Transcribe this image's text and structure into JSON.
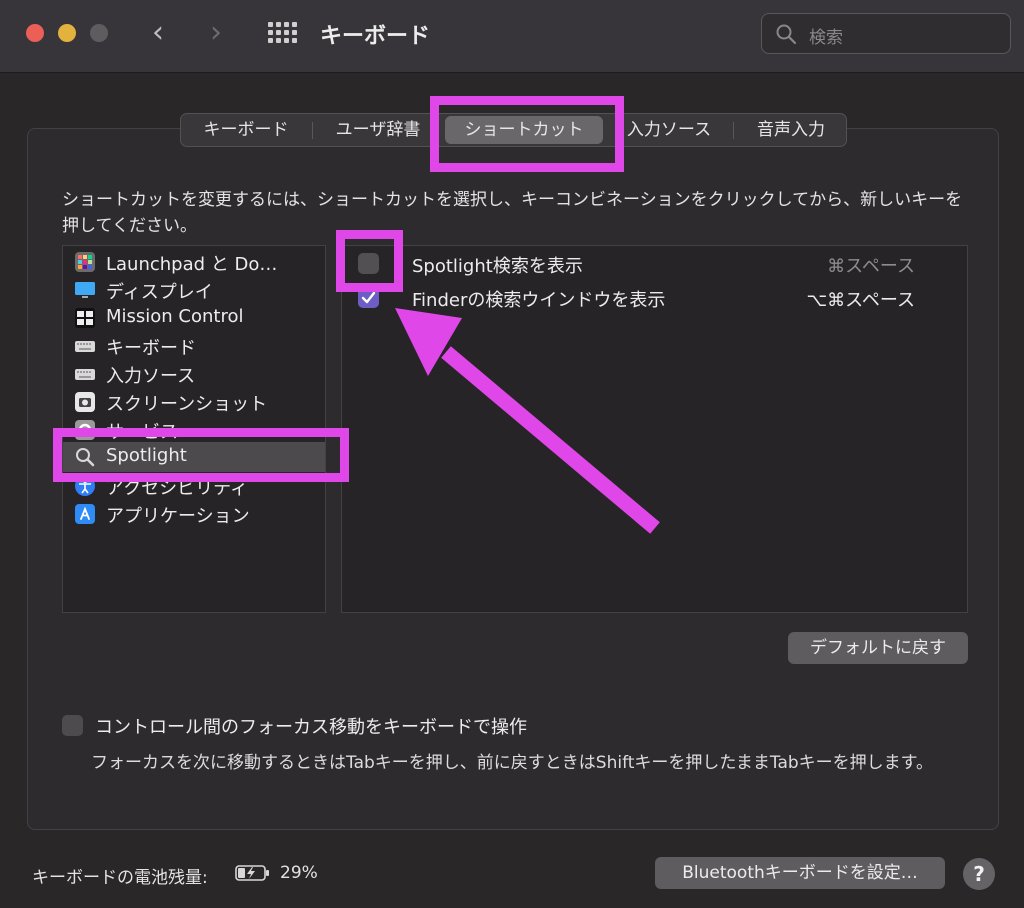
{
  "window": {
    "title": "キーボード",
    "search_placeholder": "検索",
    "traffic_light_colors": [
      "#ec5f57",
      "#e3b23c",
      "#5f5c60"
    ]
  },
  "tabs": [
    {
      "label": "キーボード",
      "selected": false
    },
    {
      "label": "ユーザ辞書",
      "selected": false
    },
    {
      "label": "ショートカット",
      "selected": true
    },
    {
      "label": "入力ソース",
      "selected": false
    },
    {
      "label": "音声入力",
      "selected": false
    }
  ],
  "instructions": "ショートカットを変更するには、ショートカットを選択し、キーコンビネーションをクリックしてから、新しいキーを押してください。",
  "categories": [
    {
      "label": "Launchpad と Do…",
      "icon": "launchpad-icon"
    },
    {
      "label": "ディスプレイ",
      "icon": "display-icon"
    },
    {
      "label": "Mission Control",
      "icon": "mission-control-icon"
    },
    {
      "label": "キーボード",
      "icon": "keyboard-icon"
    },
    {
      "label": "入力ソース",
      "icon": "input-source-icon"
    },
    {
      "label": "スクリーンショット",
      "icon": "screenshot-icon"
    },
    {
      "label": "サービス",
      "icon": "gear-icon"
    },
    {
      "label": "Spotlight",
      "icon": "spotlight-search-icon",
      "selected": true
    },
    {
      "label": "アクセシビリティ",
      "icon": "accessibility-icon"
    },
    {
      "label": "アプリケーション",
      "icon": "app-store-icon"
    }
  ],
  "shortcuts": [
    {
      "label": "Spotlight検索を表示",
      "keys": "⌘スペース",
      "checked": false
    },
    {
      "label": "Finderの検索ウインドウを表示",
      "keys": "⌥⌘スペース",
      "checked": true
    }
  ],
  "buttons": {
    "restore_defaults": "デフォルトに戻す",
    "bluetooth_setup": "Bluetoothキーボードを設定…",
    "help": "?"
  },
  "focus_option": {
    "label": "コントロール間のフォーカス移動をキーボードで操作",
    "checked": false,
    "description": "フォーカスを次に移動するときはTabキーを押し、前に戻すときはShiftキーを押したままTabキーを押します。"
  },
  "battery": {
    "label": "キーボードの電池残量:",
    "percent": "29%",
    "charging": true
  },
  "annotation": {
    "color": "#e047e8"
  }
}
